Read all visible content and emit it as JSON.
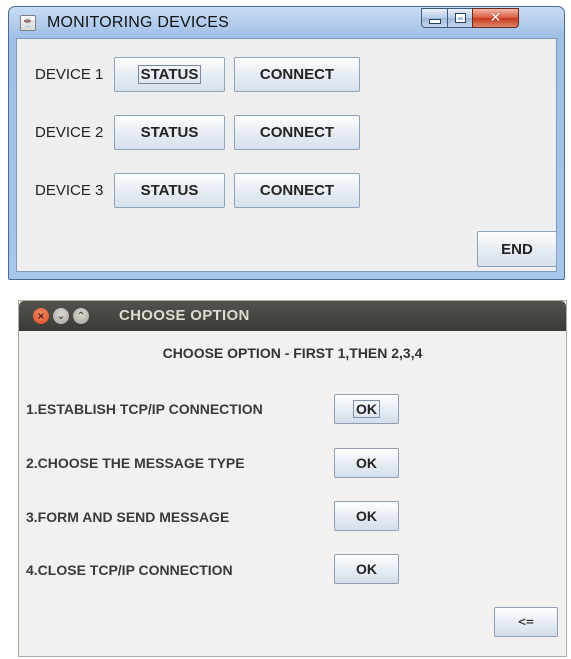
{
  "monitor_window": {
    "title": "MONITORING DEVICES",
    "icon": "java-cup-icon",
    "controls": {
      "minimize": "minimize-icon",
      "maximize": "maximize-icon",
      "close": "close-icon"
    },
    "devices": [
      {
        "label": "DEVICE 1",
        "status_label": "STATUS",
        "connect_label": "CONNECT"
      },
      {
        "label": "DEVICE 2",
        "status_label": "STATUS",
        "connect_label": "CONNECT"
      },
      {
        "label": "DEVICE 3",
        "status_label": "STATUS",
        "connect_label": "CONNECT"
      }
    ],
    "end_label": "END"
  },
  "option_window": {
    "title": "CHOOSE OPTION",
    "heading": "CHOOSE OPTION - FIRST 1,THEN 2,3,4",
    "options": [
      {
        "label": "1.ESTABLISH TCP/IP CONNECTION",
        "button": "OK"
      },
      {
        "label": "2.CHOOSE THE MESSAGE TYPE",
        "button": "OK"
      },
      {
        "label": "3.FORM AND SEND MESSAGE",
        "button": "OK"
      },
      {
        "label": "4.CLOSE TCP/IP CONNECTION",
        "button": "OK"
      }
    ],
    "back_label": "<="
  },
  "colors": {
    "win7_frame": "#a8c6ea",
    "ubuntu_titlebar": "#3c3b37",
    "ubuntu_close": "#dc4b1f",
    "client_bg": "#eeeeee"
  }
}
